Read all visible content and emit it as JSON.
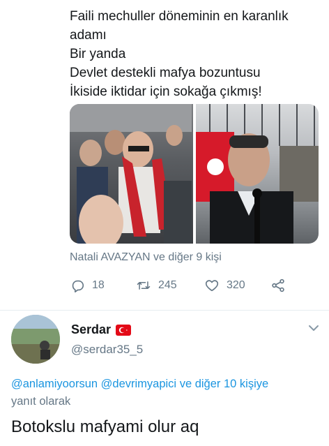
{
  "tweet": {
    "lines": [
      "Faili mechuller döneminin en karanlık",
      "adamı",
      "Bir yanda",
      "Devlet destekli mafya bozuntusu",
      "İkiside iktidar için sokağa çıkmış!"
    ],
    "tagged": "Natali AVAZYAN ve diğer 9 kişi",
    "replies": "18",
    "retweets": "245",
    "likes": "320"
  },
  "reply": {
    "display_name": "Serdar",
    "handle": "@serdar35_5",
    "mention1": "@anlamiyoorsun",
    "mention2": "@devrimyapici",
    "others": "ve diğer 10 kişiye",
    "replying_to": "yanıt olarak",
    "text": "Botokslu mafyami olur aq"
  },
  "colors": {
    "link": "#1b95e0",
    "secondary": "#657786",
    "flag": "#e30a17"
  },
  "icons": [
    "reply-icon",
    "retweet-icon",
    "like-icon",
    "share-icon",
    "chevron-down-icon",
    "turkey-flag-icon"
  ]
}
